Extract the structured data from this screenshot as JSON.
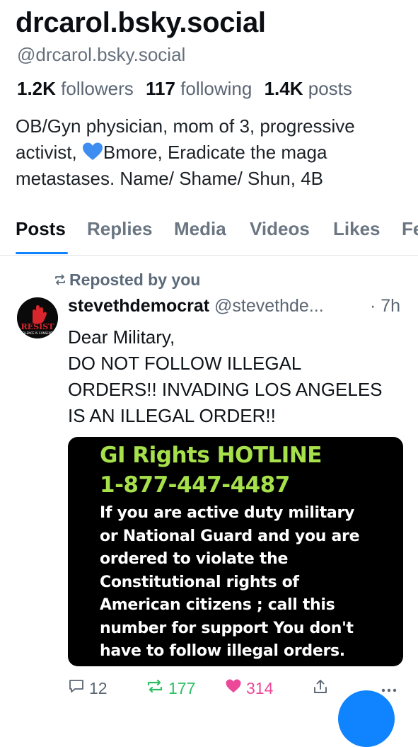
{
  "profile": {
    "display_name": "drcarol.bsky.social",
    "handle": "@drcarol.bsky.social",
    "followers_count": "1.2K",
    "followers_label": "followers",
    "following_count": "117",
    "following_label": "following",
    "posts_count": "1.4K",
    "posts_label": "posts",
    "bio_part1": "OB/Gyn physician, mom of 3, progressive activist, ",
    "bio_part2": "Bmore, Eradicate the maga metastases. Name/ Shame/ Shun, 4B"
  },
  "tabs": [
    {
      "label": "Posts",
      "active": true
    },
    {
      "label": "Replies"
    },
    {
      "label": "Media"
    },
    {
      "label": "Videos"
    },
    {
      "label": "Likes"
    },
    {
      "label": "Fe"
    }
  ],
  "post": {
    "repost_label": "Reposted by you",
    "author_name": "stevethdemocrat",
    "author_handle": "@stevethde...",
    "time": "· 7h",
    "avatar_text": "RESIST",
    "avatar_subtext": "SILENCE IS CONSENT",
    "text_lines": [
      "Dear Military,",
      "DO NOT FOLLOW ILLEGAL",
      "ORDERS!! INVADING LOS ANGELES",
      "IS AN ILLEGAL ORDER!!"
    ],
    "image": {
      "title": "GI Rights HOTLINE",
      "phone": "1-877-447-4487",
      "body_lines": [
        "If  you are active duty military",
        "or National Guard and you are",
        "ordered to violate the",
        "Constitutional rights of",
        "American citizens ; call this",
        "number for support    You don't",
        "have to follow illegal orders."
      ]
    },
    "actions": {
      "replies": "12",
      "reposts": "177",
      "likes": "314"
    }
  },
  "colors": {
    "accent": "#1083fe",
    "repost_active": "#2bbf63",
    "like_active": "#ec4899",
    "hotline_green": "#a6e04a"
  }
}
